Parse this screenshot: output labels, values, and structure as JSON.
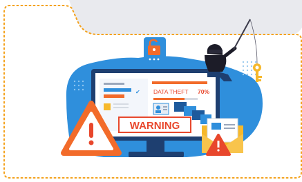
{
  "screen": {
    "data_theft_label": "DATA THEFT",
    "data_theft_percent": "70%",
    "warning_label": "WARNING"
  },
  "colors": {
    "accent_blue": "#2f8fdc",
    "dark_blue": "#1e5a9c",
    "warning_orange": "#f26b2a",
    "warning_red": "#e8472c",
    "border_orange": "#f4a11b",
    "key_yellow": "#f6b82b"
  },
  "icons": [
    "padlock-icon",
    "hacker-figure",
    "key-icon",
    "warning-triangle-icon",
    "envelope-warning-icon",
    "monitor-icon",
    "fishing-rod-icon"
  ]
}
